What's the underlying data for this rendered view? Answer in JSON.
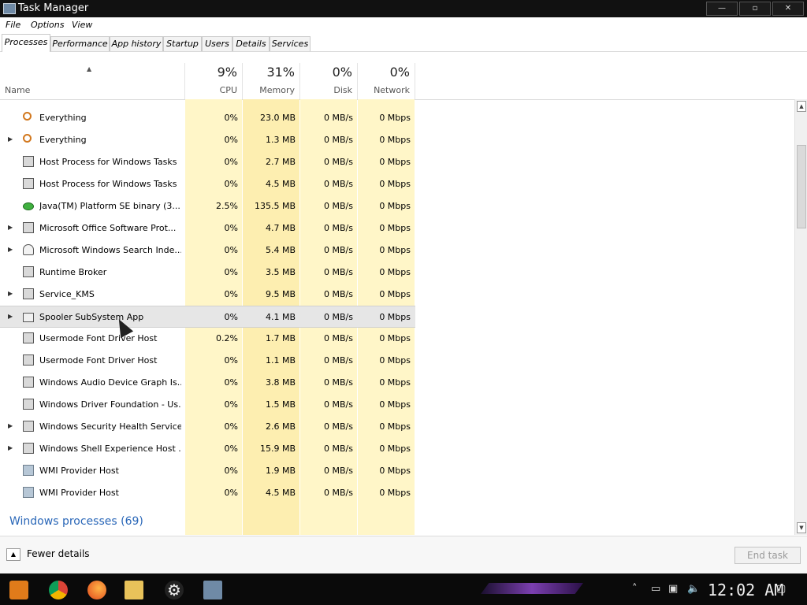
{
  "window": {
    "title": "Task Manager",
    "minimize": "—",
    "maximize": "▫",
    "close": "✕"
  },
  "menu": [
    "File",
    "Options",
    "View"
  ],
  "tabs": [
    "Processes",
    "Performance",
    "App history",
    "Startup",
    "Users",
    "Details",
    "Services"
  ],
  "active_tab": "Processes",
  "columns": {
    "name": "Name",
    "cpu": {
      "pct": "9%",
      "label": "CPU"
    },
    "memory": {
      "pct": "31%",
      "label": "Memory"
    },
    "disk": {
      "pct": "0%",
      "label": "Disk"
    },
    "network": {
      "pct": "0%",
      "label": "Network"
    }
  },
  "rows": [
    {
      "name": "Everything",
      "cpu": "0%",
      "mem": "23.0 MB",
      "disk": "0 MB/s",
      "net": "0 Mbps",
      "expandable": false,
      "icon": "search-icon"
    },
    {
      "name": "Everything",
      "cpu": "0%",
      "mem": "1.3 MB",
      "disk": "0 MB/s",
      "net": "0 Mbps",
      "expandable": true,
      "icon": "search-icon"
    },
    {
      "name": "Host Process for Windows Tasks",
      "cpu": "0%",
      "mem": "2.7 MB",
      "disk": "0 MB/s",
      "net": "0 Mbps",
      "expandable": false,
      "icon": "app-icon"
    },
    {
      "name": "Host Process for Windows Tasks",
      "cpu": "0%",
      "mem": "4.5 MB",
      "disk": "0 MB/s",
      "net": "0 Mbps",
      "expandable": false,
      "icon": "app-icon"
    },
    {
      "name": "Java(TM) Platform SE binary (3...",
      "cpu": "2.5%",
      "mem": "135.5 MB",
      "disk": "0 MB/s",
      "net": "0 Mbps",
      "expandable": false,
      "icon": "java-icon"
    },
    {
      "name": "Microsoft Office Software Prot...",
      "cpu": "0%",
      "mem": "4.7 MB",
      "disk": "0 MB/s",
      "net": "0 Mbps",
      "expandable": true,
      "icon": "app-icon"
    },
    {
      "name": "Microsoft Windows Search Inde...",
      "cpu": "0%",
      "mem": "5.4 MB",
      "disk": "0 MB/s",
      "net": "0 Mbps",
      "expandable": true,
      "icon": "user-icon"
    },
    {
      "name": "Runtime Broker",
      "cpu": "0%",
      "mem": "3.5 MB",
      "disk": "0 MB/s",
      "net": "0 Mbps",
      "expandable": false,
      "icon": "app-icon"
    },
    {
      "name": "Service_KMS",
      "cpu": "0%",
      "mem": "9.5 MB",
      "disk": "0 MB/s",
      "net": "0 Mbps",
      "expandable": true,
      "icon": "app-icon"
    },
    {
      "name": "Spooler SubSystem App",
      "cpu": "0%",
      "mem": "4.1 MB",
      "disk": "0 MB/s",
      "net": "0 Mbps",
      "expandable": true,
      "icon": "printer-icon",
      "selected": true
    },
    {
      "name": "Usermode Font Driver Host",
      "cpu": "0.2%",
      "mem": "1.7 MB",
      "disk": "0 MB/s",
      "net": "0 Mbps",
      "expandable": false,
      "icon": "app-icon"
    },
    {
      "name": "Usermode Font Driver Host",
      "cpu": "0%",
      "mem": "1.1 MB",
      "disk": "0 MB/s",
      "net": "0 Mbps",
      "expandable": false,
      "icon": "app-icon"
    },
    {
      "name": "Windows Audio Device Graph Is...",
      "cpu": "0%",
      "mem": "3.8 MB",
      "disk": "0 MB/s",
      "net": "0 Mbps",
      "expandable": false,
      "icon": "app-icon"
    },
    {
      "name": "Windows Driver Foundation - Us...",
      "cpu": "0%",
      "mem": "1.5 MB",
      "disk": "0 MB/s",
      "net": "0 Mbps",
      "expandable": false,
      "icon": "app-icon"
    },
    {
      "name": "Windows Security Health Service",
      "cpu": "0%",
      "mem": "2.6 MB",
      "disk": "0 MB/s",
      "net": "0 Mbps",
      "expandable": true,
      "icon": "app-icon"
    },
    {
      "name": "Windows Shell Experience Host ...",
      "cpu": "0%",
      "mem": "15.9 MB",
      "disk": "0 MB/s",
      "net": "0 Mbps",
      "expandable": true,
      "icon": "window-icon"
    },
    {
      "name": "WMI Provider Host",
      "cpu": "0%",
      "mem": "1.9 MB",
      "disk": "0 MB/s",
      "net": "0 Mbps",
      "expandable": false,
      "icon": "wmi-icon"
    },
    {
      "name": "WMI Provider Host",
      "cpu": "0%",
      "mem": "4.5 MB",
      "disk": "0 MB/s",
      "net": "0 Mbps",
      "expandable": false,
      "icon": "wmi-icon"
    }
  ],
  "group_title": "Windows processes (69)",
  "footer": {
    "fewer_details": "Fewer details",
    "end_task": "End task"
  },
  "taskbar": {
    "clock": "12:02 AM",
    "icons": [
      "start-icon",
      "chrome-icon",
      "firefox-icon",
      "folder-icon",
      "settings-icon",
      "task-manager-icon"
    ]
  },
  "colors": {
    "cpu_col": "#fff6c8",
    "mem_col": "#fdeeb0",
    "group_title": "#2a67b8",
    "selected_row": "#e6e6e6"
  }
}
